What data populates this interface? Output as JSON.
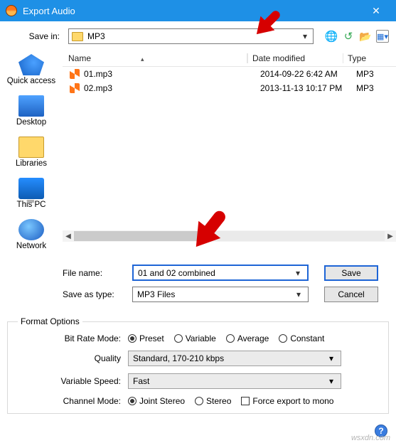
{
  "titlebar": {
    "title": "Export Audio",
    "close": "✕"
  },
  "save_in": {
    "label": "Save in:",
    "value": "MP3"
  },
  "file_list": {
    "headers": {
      "name": "Name",
      "date": "Date modified",
      "type": "Type"
    },
    "rows": [
      {
        "name": "01.mp3",
        "date": "2014-09-22 6:42 AM",
        "type": "MP3"
      },
      {
        "name": "02.mp3",
        "date": "2013-11-13 10:17 PM",
        "type": "MP3"
      }
    ]
  },
  "places": {
    "quick": "Quick access",
    "desktop": "Desktop",
    "libraries": "Libraries",
    "thispc": "This PC",
    "network": "Network"
  },
  "file_name": {
    "label": "File name:",
    "value": "01 and 02 combined"
  },
  "save_type": {
    "label": "Save as type:",
    "value": "MP3 Files"
  },
  "buttons": {
    "save": "Save",
    "cancel": "Cancel"
  },
  "format": {
    "legend": "Format Options",
    "bitrate_label": "Bit Rate Mode:",
    "bitrate_options": {
      "preset": "Preset",
      "variable": "Variable",
      "average": "Average",
      "constant": "Constant"
    },
    "quality_label": "Quality",
    "quality_value": "Standard, 170-210 kbps",
    "speed_label": "Variable Speed:",
    "speed_value": "Fast",
    "channel_label": "Channel Mode:",
    "channel_options": {
      "joint": "Joint Stereo",
      "stereo": "Stereo"
    },
    "force_mono": "Force export to mono"
  },
  "watermark": "wsxdn.com"
}
